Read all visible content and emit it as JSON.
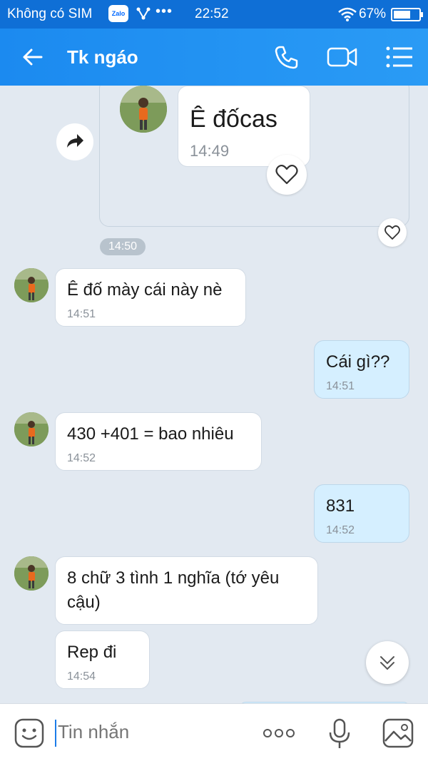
{
  "status_bar": {
    "carrier": "Không có SIM",
    "zalo_badge": "Zalo",
    "dots": "•••",
    "time": "22:52",
    "battery_percent": "67%",
    "battery_level": 0.67
  },
  "header": {
    "contact_name": "Tk ngáo",
    "icons": [
      "back-arrow-icon",
      "phone-call-icon",
      "video-call-icon",
      "menu-list-icon"
    ]
  },
  "messages": {
    "quoted": {
      "text": "Ê đốcas",
      "time": "14:49"
    },
    "time_separator": "14:50",
    "m1": {
      "text": "Ê đố mày cái này nè",
      "time": "14:51"
    },
    "m2": {
      "text": "Cái gì??",
      "time": "14:51"
    },
    "m3": {
      "text": "430 +401 = bao nhiêu",
      "time": "14:52"
    },
    "m4": {
      "text": "831",
      "time": "14:52"
    },
    "m5": {
      "line1": "8 chữ 3 tình  1 nghĩa (tớ yêu",
      "line2": "cậu)"
    },
    "m6": {
      "text": "Rep đi",
      "time": "14:54"
    }
  },
  "input": {
    "placeholder": "Tin nhắn",
    "value": ""
  },
  "colors": {
    "header_blue": "#1b8af0",
    "status_blue": "#0f6fd6",
    "chat_background": "#e2e9f1",
    "sent_bubble": "#d5efff"
  }
}
